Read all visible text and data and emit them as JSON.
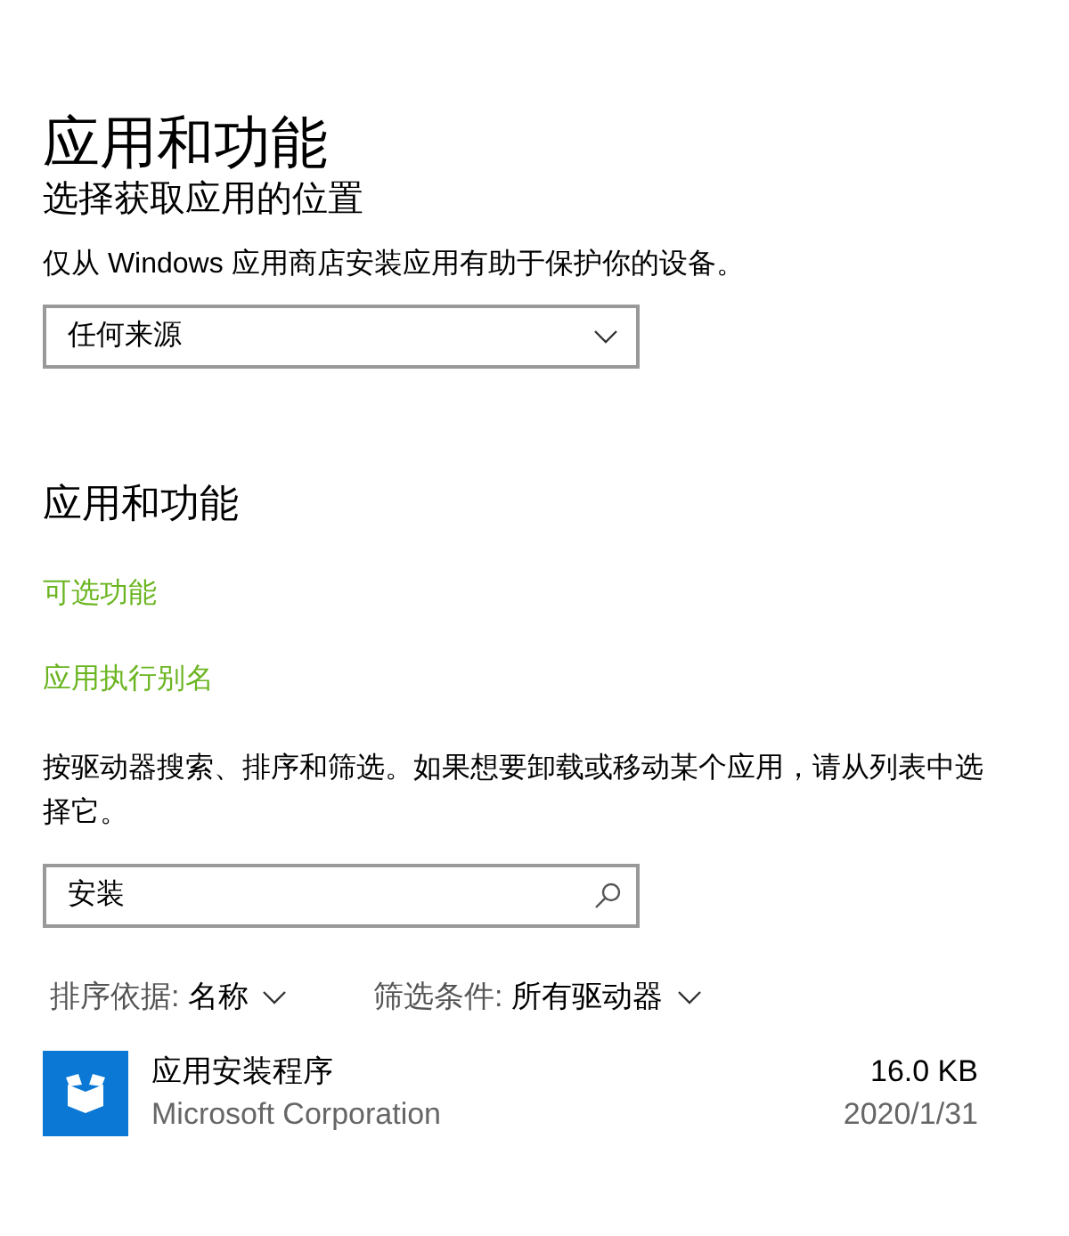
{
  "page_title": "应用和功能",
  "install_section": {
    "heading": "选择获取应用的位置",
    "description": "仅从 Windows 应用商店安装应用有助于保护你的设备。",
    "dropdown": {
      "value": "任何来源"
    }
  },
  "apps_section": {
    "heading": "应用和功能",
    "links": [
      "可选功能",
      "应用执行别名"
    ],
    "description": "按驱动器搜索、排序和筛选。如果想要卸载或移动某个应用，请从列表中选择它。",
    "search": {
      "value": "安装"
    },
    "sort": {
      "label": "排序依据:",
      "value": "名称"
    },
    "filter": {
      "label": "筛选条件:",
      "value": "所有驱动器"
    },
    "apps": [
      {
        "name": "应用安装程序",
        "publisher": "Microsoft Corporation",
        "size": "16.0 KB",
        "date": "2020/1/31"
      }
    ]
  }
}
